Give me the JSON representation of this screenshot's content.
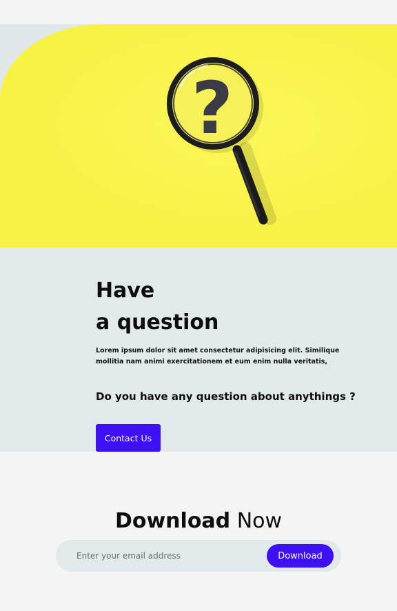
{
  "hero": {
    "image_description_icon": "magnifying-glass-question-icon"
  },
  "content": {
    "title_line1": "Have",
    "title_line2": "a question",
    "lorem": "Lorem ipsum dolor sit amet consectetur adipisicing elit. Similique mollitia nam animi exercitationem et eum enim nulla veritatis,",
    "question": "Do you have any question about anythings ?",
    "contact_label": "Contact Us"
  },
  "download": {
    "title_bold": "Download",
    "title_light": "Now",
    "email_placeholder": "Enter your email address",
    "button_label": "Download"
  },
  "colors": {
    "accent": "#3d10f5",
    "hero_yellow": "#f8f247",
    "band": "#e2e9ea",
    "page_bg": "#f4f4f4"
  }
}
